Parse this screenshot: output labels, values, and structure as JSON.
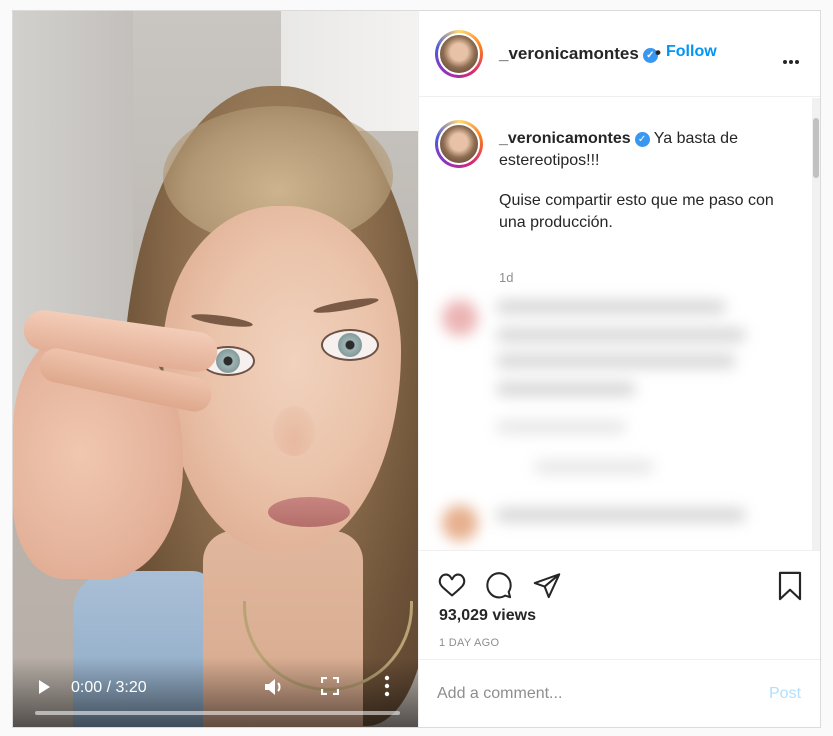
{
  "video": {
    "time_display": "0:00 / 3:20",
    "progress": 0.0
  },
  "header": {
    "username": "_veronicamontes",
    "separator": "•",
    "follow_label": "Follow"
  },
  "caption": {
    "username": "_veronicamontes",
    "line1": "Ya basta de estereotipos!!!",
    "line2": "Quise compartir esto que me paso con una producción.",
    "time": "1d"
  },
  "stats": {
    "views": "93,029 views",
    "ago": "1 DAY AGO"
  },
  "comment_box": {
    "placeholder": "Add a comment...",
    "post_label": "Post"
  },
  "colors": {
    "accent": "#0095f6",
    "post_disabled": "#b2dffc",
    "verified": "#3897f0"
  },
  "icons": [
    "play-icon",
    "volume-icon",
    "fullscreen-icon",
    "video-more-icon",
    "verified-icon",
    "more-options-icon",
    "heart-icon",
    "comment-icon",
    "share-icon",
    "bookmark-icon"
  ]
}
